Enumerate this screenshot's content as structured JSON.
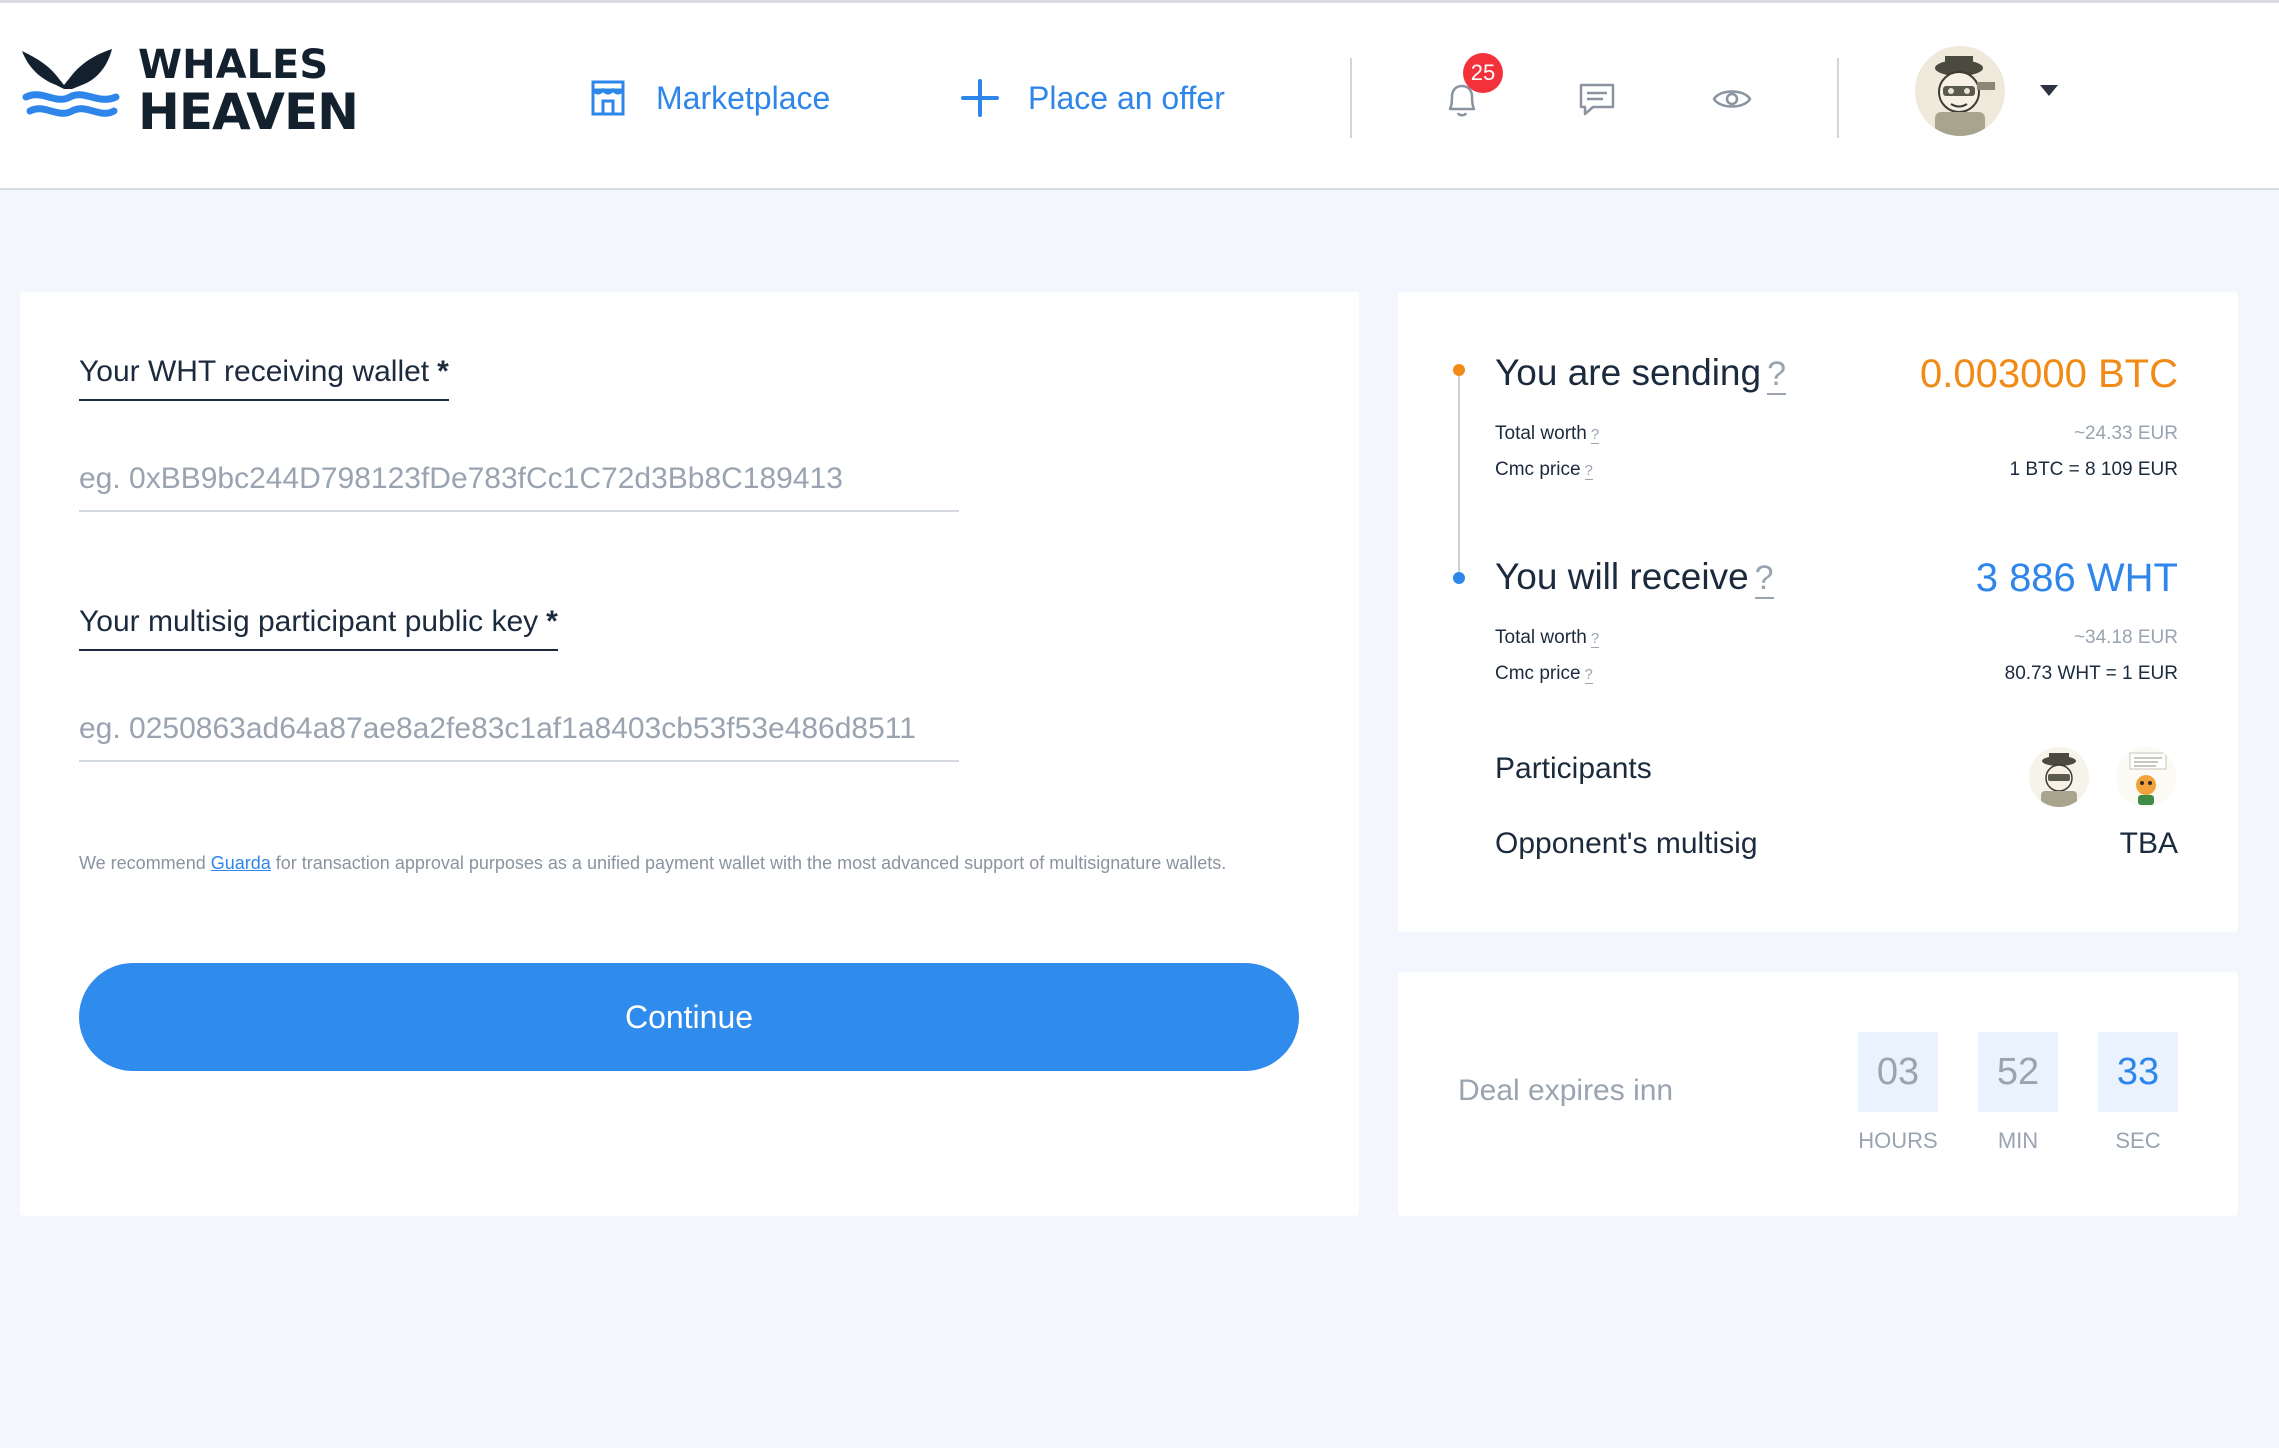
{
  "brand": {
    "line1": "WHALES",
    "line2": "HEAVEN"
  },
  "nav": {
    "marketplace": "Marketplace",
    "place_offer": "Place an offer"
  },
  "header": {
    "notification_count": "25",
    "icons": [
      "store-icon",
      "plus-icon",
      "bell-icon",
      "chat-icon",
      "eye-icon",
      "chevron-down-icon"
    ]
  },
  "form": {
    "wallet_label": "Your WHT receiving wallet",
    "wallet_placeholder": "eg. 0xBB9bc244D798123fDe783fCc1C72d3Bb8C189413",
    "wallet_value": "",
    "key_label": "Your multisig participant public key",
    "key_placeholder": "eg. 0250863ad64a87ae8a2fe83c1af1a8403cb53f53e486d8511",
    "key_value": "",
    "required_mark": "*",
    "recommend_prefix": "We recommend ",
    "recommend_link": "Guarda",
    "recommend_suffix": " for transaction approval purposes as a unified payment wallet with the most advanced support of multisignature wallets.",
    "continue_label": "Continue"
  },
  "summary": {
    "sending_title": "You are sending",
    "sending_amount": "0.003000 BTC",
    "sending_total_worth_label": "Total worth",
    "sending_total_worth": "~24.33 EUR",
    "sending_cmc_label": "Cmc price",
    "sending_cmc": "1 BTC = 8 109 EUR",
    "receiving_title": "You will receive",
    "receiving_amount": "3 886 WHT",
    "receiving_total_worth_label": "Total worth",
    "receiving_total_worth": "~34.18 EUR",
    "receiving_cmc_label": "Cmc price",
    "receiving_cmc": "80.73 WHT = 1 EUR",
    "participants_label": "Participants",
    "opponent_label": "Opponent's multisig",
    "opponent_value": "TBA",
    "help": "?",
    "colors": {
      "sending": "#f28a16",
      "receiving": "#2f86ea"
    }
  },
  "timer": {
    "label": "Deal expires inn",
    "hours": "03",
    "hours_label": "HOURS",
    "min": "52",
    "min_label": "MIN",
    "sec": "33",
    "sec_label": "SEC"
  }
}
